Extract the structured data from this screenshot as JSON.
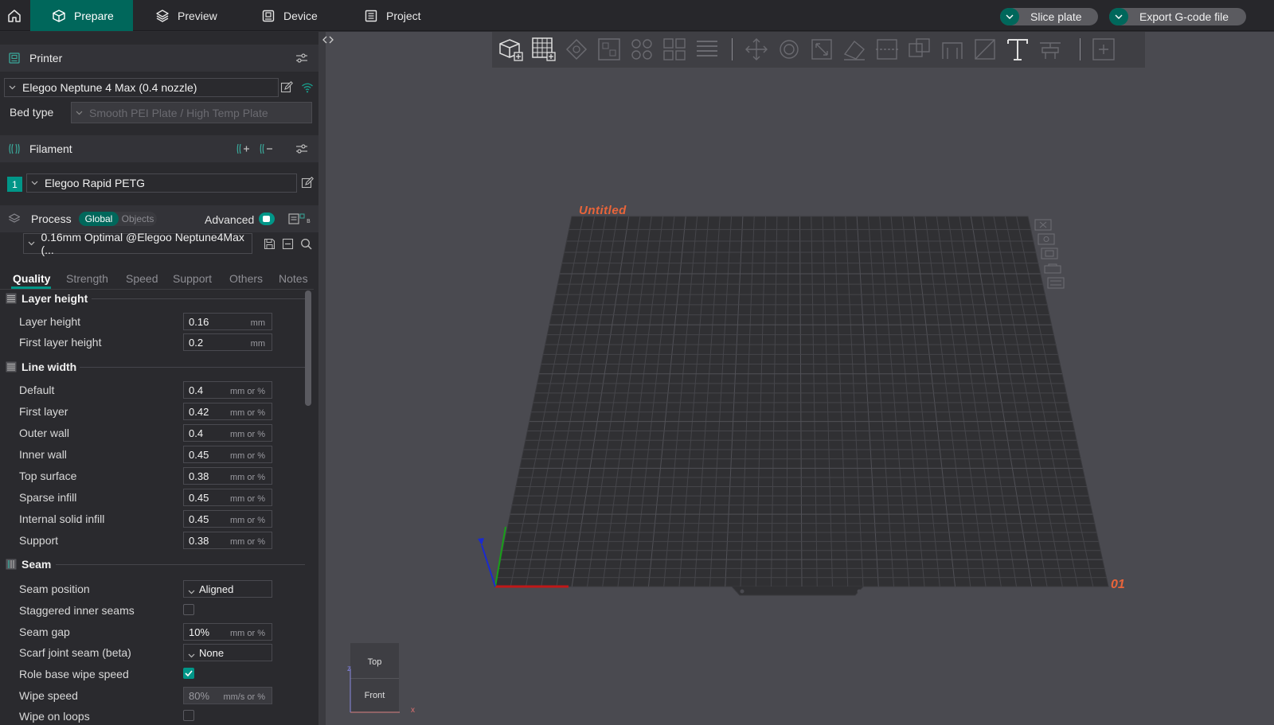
{
  "topbar": {
    "tabs": [
      {
        "label": "Prepare",
        "icon": "cube-icon",
        "active": true
      },
      {
        "label": "Preview",
        "icon": "layers-icon",
        "active": false
      },
      {
        "label": "Device",
        "icon": "device-icon",
        "active": false
      },
      {
        "label": "Project",
        "icon": "project-icon",
        "active": false
      }
    ],
    "slice_label": "Slice plate",
    "export_label": "Export G-code file"
  },
  "printer": {
    "title": "Printer",
    "selected": "Elegoo Neptune 4 Max (0.4 nozzle)",
    "bed_type_label": "Bed type",
    "bed_type_value": "Smooth PEI Plate / High Temp Plate"
  },
  "filament": {
    "title": "Filament",
    "slot_number": "1",
    "selected": "Elegoo Rapid PETG",
    "slot_color": "#009688"
  },
  "process": {
    "title": "Process",
    "scope_global": "Global",
    "scope_objects": "Objects",
    "advanced_label": "Advanced",
    "advanced_on": true,
    "preset": "0.16mm Optimal @Elegoo Neptune4Max (..."
  },
  "subtabs": [
    "Quality",
    "Strength",
    "Speed",
    "Support",
    "Others",
    "Notes"
  ],
  "settings": {
    "layer_height": {
      "title": "Layer height",
      "rows": [
        {
          "label": "Layer height",
          "value": "0.16",
          "unit": "mm"
        },
        {
          "label": "First layer height",
          "value": "0.2",
          "unit": "mm"
        }
      ]
    },
    "line_width": {
      "title": "Line width",
      "rows": [
        {
          "label": "Default",
          "value": "0.4",
          "unit": "mm or %"
        },
        {
          "label": "First layer",
          "value": "0.42",
          "unit": "mm or %"
        },
        {
          "label": "Outer wall",
          "value": "0.4",
          "unit": "mm or %"
        },
        {
          "label": "Inner wall",
          "value": "0.45",
          "unit": "mm or %"
        },
        {
          "label": "Top surface",
          "value": "0.38",
          "unit": "mm or %"
        },
        {
          "label": "Sparse infill",
          "value": "0.45",
          "unit": "mm or %"
        },
        {
          "label": "Internal solid infill",
          "value": "0.45",
          "unit": "mm or %"
        },
        {
          "label": "Support",
          "value": "0.38",
          "unit": "mm or %"
        }
      ]
    },
    "seam": {
      "title": "Seam",
      "seam_position_label": "Seam position",
      "seam_position_value": "Aligned",
      "staggered_label": "Staggered inner seams",
      "staggered_checked": false,
      "seam_gap_label": "Seam gap",
      "seam_gap_value": "10%",
      "seam_gap_unit": "mm or %",
      "scarf_label": "Scarf joint seam (beta)",
      "scarf_value": "None",
      "role_wipe_label": "Role base wipe speed",
      "role_wipe_checked": true,
      "wipe_speed_label": "Wipe speed",
      "wipe_speed_value": "80%",
      "wipe_speed_unit": "mm/s or %",
      "wipe_loops_label": "Wipe on loops"
    }
  },
  "viewport": {
    "plate_name": "Untitled",
    "plate_number": "01",
    "view_top": "Top",
    "view_front": "Front",
    "axis_x": "x",
    "axis_z": "z"
  },
  "colors": {
    "accent": "#009688",
    "accent_dark": "#00675b",
    "plate_label": "#e8643a"
  }
}
